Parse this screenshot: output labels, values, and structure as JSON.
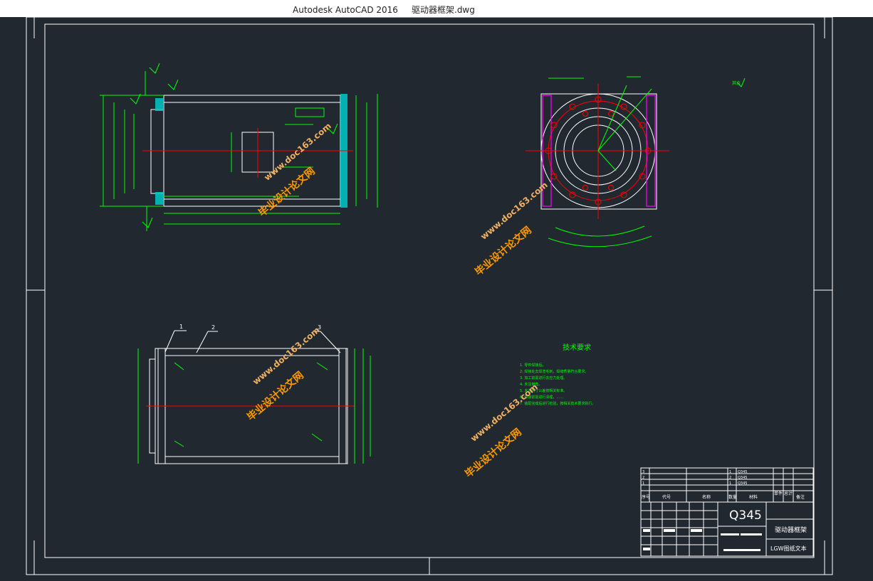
{
  "window": {
    "app_name": "Autodesk AutoCAD 2016",
    "file_name": "驱动器框架.dwg"
  },
  "colors": {
    "background": "#212830",
    "frame": "#ffffff",
    "dimension": "#00ff00",
    "center_line": "#ff0000",
    "section_hatch": "#00c8c8",
    "side_plate": "#ff00ff",
    "watermark": "#ff9900",
    "watermark_url": "#f0b060"
  },
  "drawing": {
    "tech_req_title": "技术要求",
    "tech_req_lines": [
      "1. 零件焊接后，",
      "2. 焊接处去焊渣毛刺，焊缝质量符合要求。",
      "3. 加工前需进行去应力处理。",
      "4. 未注倒角。",
      "5. 未注尺寸公差按相关标准。",
      "6. 焊接前需进行清理，……",
      "7. 装配完成后进行检验，按相关技术要求执行。"
    ],
    "roughness_symbol": "其余",
    "balloons": [
      "1",
      "2",
      "3"
    ]
  },
  "title_block": {
    "material": "Q345",
    "part_name": "驱动器框架",
    "drawing_type": "LGW图纸文本",
    "header": [
      "序号",
      "代号",
      "名称",
      "数量",
      "材料",
      "单件",
      "总计",
      "备注"
    ],
    "rows": [
      {
        "no": "3",
        "qty": "1",
        "material": "Q345"
      },
      {
        "no": "2",
        "qty": "2",
        "material": "Q345"
      },
      {
        "no": "1",
        "qty": "1",
        "material": "Q345"
      }
    ]
  },
  "watermarks": [
    {
      "text": "毕业设计论文网",
      "url": "www.doc163.com"
    },
    {
      "text": "毕业设计论文网",
      "url": "www.doc163.com"
    },
    {
      "text": "毕业设计论文网",
      "url": "www.doc163.com"
    },
    {
      "text": "毕业设计论文网",
      "url": "www.doc163.com"
    }
  ]
}
